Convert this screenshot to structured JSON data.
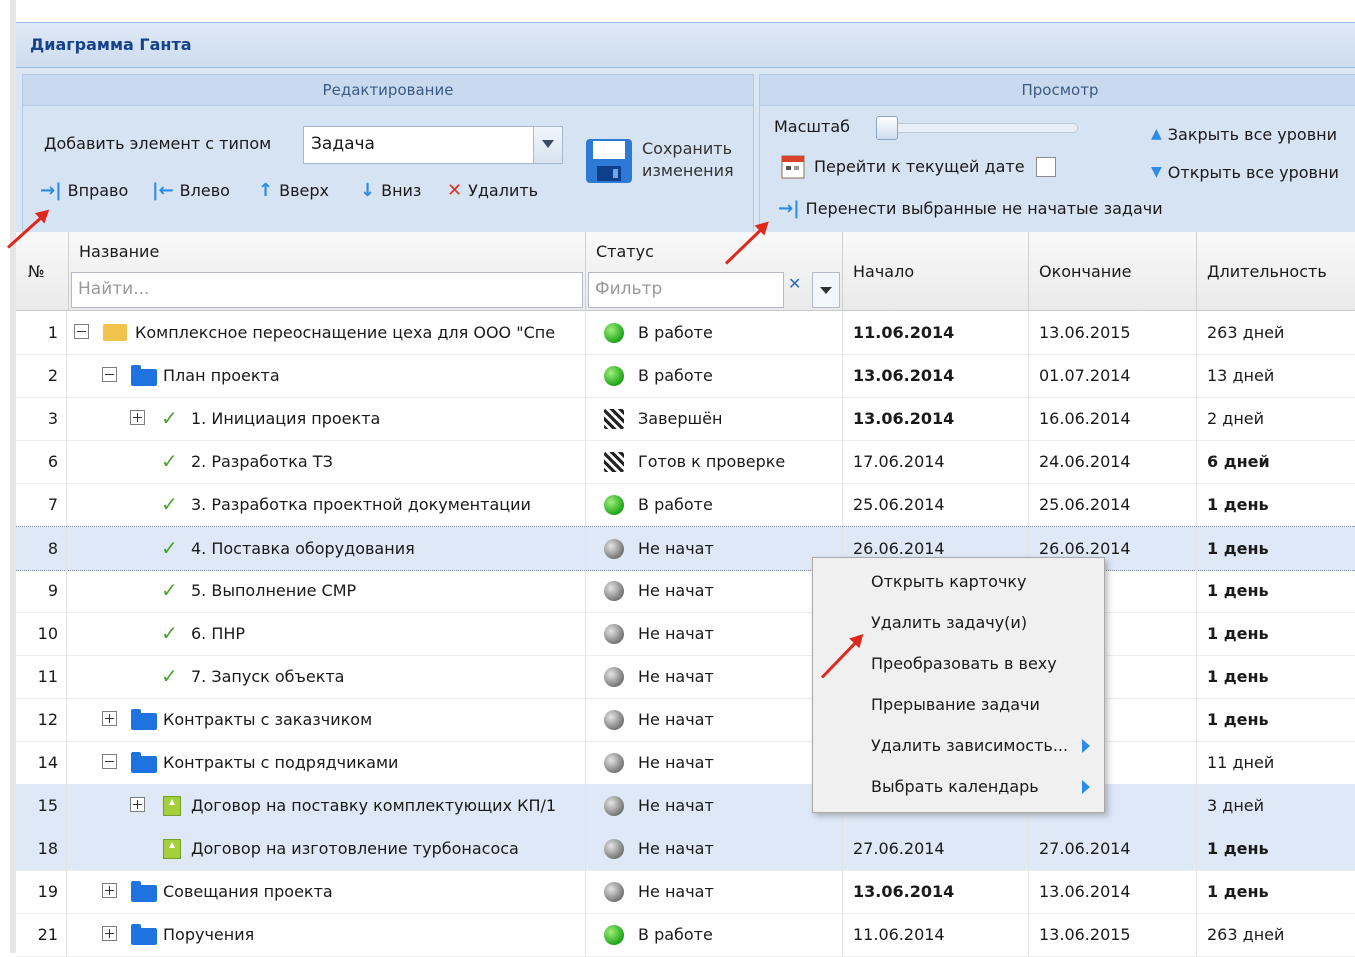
{
  "window_title": "Диаграмма Ганта",
  "toolbar": {
    "edit_group": "Редактирование",
    "view_group": "Просмотр",
    "add_label": "Добавить элемент с типом",
    "type_value": "Задача",
    "save_line1": "Сохранить",
    "save_line2": "изменения",
    "right": "Вправо",
    "left": "Влево",
    "up": "Вверх",
    "down": "Вниз",
    "delete": "Удалить",
    "scale_label": "Масштаб",
    "goto_date": "Перейти к текущей дате",
    "move_tasks": "Перенести выбранные не начатые задачи",
    "collapse_all": "Закрыть все уровни",
    "expand_all": "Открыть все уровни"
  },
  "grid": {
    "headers": {
      "num": "№",
      "name": "Название",
      "status": "Статус",
      "start": "Начало",
      "end": "Окончание",
      "duration": "Длительность"
    },
    "name_placeholder": "Найти...",
    "status_placeholder": "Фильтр",
    "rows": [
      {
        "num": "1",
        "name": "Комплексное переоснащение цеха для ООО \"Спе",
        "status": "В работе",
        "start": "11.06.2014",
        "end": "13.06.2015",
        "duration": "263 дней"
      },
      {
        "num": "2",
        "name": "План проекта",
        "status": "В работе",
        "start": "13.06.2014",
        "end": "01.07.2014",
        "duration": "13 дней"
      },
      {
        "num": "3",
        "name": "1. Инициация проекта",
        "status": "Завершён",
        "start": "13.06.2014",
        "end": "16.06.2014",
        "duration": "2 дней"
      },
      {
        "num": "6",
        "name": "2. Разработка ТЗ",
        "status": "Готов к проверке",
        "start": "17.06.2014",
        "end": "24.06.2014",
        "duration": "6 дней"
      },
      {
        "num": "7",
        "name": "3. Разработка проектной документации",
        "status": "В работе",
        "start": "25.06.2014",
        "end": "25.06.2014",
        "duration": "1 день"
      },
      {
        "num": "8",
        "name": "4. Поставка оборудования",
        "status": "Не начат",
        "start": "26.06.2014",
        "end": "26.06.2014",
        "duration": "1 день"
      },
      {
        "num": "9",
        "name": "5. Выполнение СМР",
        "status": "Не начат",
        "start": "",
        "end": "014",
        "duration": "1 день"
      },
      {
        "num": "10",
        "name": "6. ПНР",
        "status": "Не начат",
        "start": "",
        "end": "014",
        "duration": "1 день"
      },
      {
        "num": "11",
        "name": "7. Запуск объекта",
        "status": "Не начат",
        "start": "",
        "end": "014",
        "duration": "1 день"
      },
      {
        "num": "12",
        "name": "Контракты с заказчиком",
        "status": "Не начат",
        "start": "",
        "end": "014",
        "duration": "1 день"
      },
      {
        "num": "14",
        "name": "Контракты с подрядчиками",
        "status": "Не начат",
        "start": "",
        "end": "014",
        "duration": "11 дней"
      },
      {
        "num": "15",
        "name": "Договор на поставку комплектующих КП/1",
        "status": "Не начат",
        "start": "",
        "end": "014",
        "duration": "3 дней"
      },
      {
        "num": "18",
        "name": "Договор на изготовление турбонасоса",
        "status": "Не начат",
        "start": "27.06.2014",
        "end": "27.06.2014",
        "duration": "1 день"
      },
      {
        "num": "19",
        "name": "Совещания проекта",
        "status": "Не начат",
        "start": "13.06.2014",
        "end": "13.06.2014",
        "duration": "1 день"
      },
      {
        "num": "21",
        "name": "Поручения",
        "status": "В работе",
        "start": "11.06.2014",
        "end": "13.06.2015",
        "duration": "263 дней"
      }
    ]
  },
  "context_menu": [
    "Открыть карточку",
    "Удалить задачу(и)",
    "Преобразовать в веху",
    "Прерывание задачи",
    "Удалить зависимость...",
    "Выбрать календарь"
  ],
  "colors": {
    "header_blue": "#15428b",
    "toolbar_bg": "#dae6f4",
    "selected_row": "#dfe8f6",
    "annotation_red": "#e0271d",
    "status_green": "#1fa51a"
  }
}
